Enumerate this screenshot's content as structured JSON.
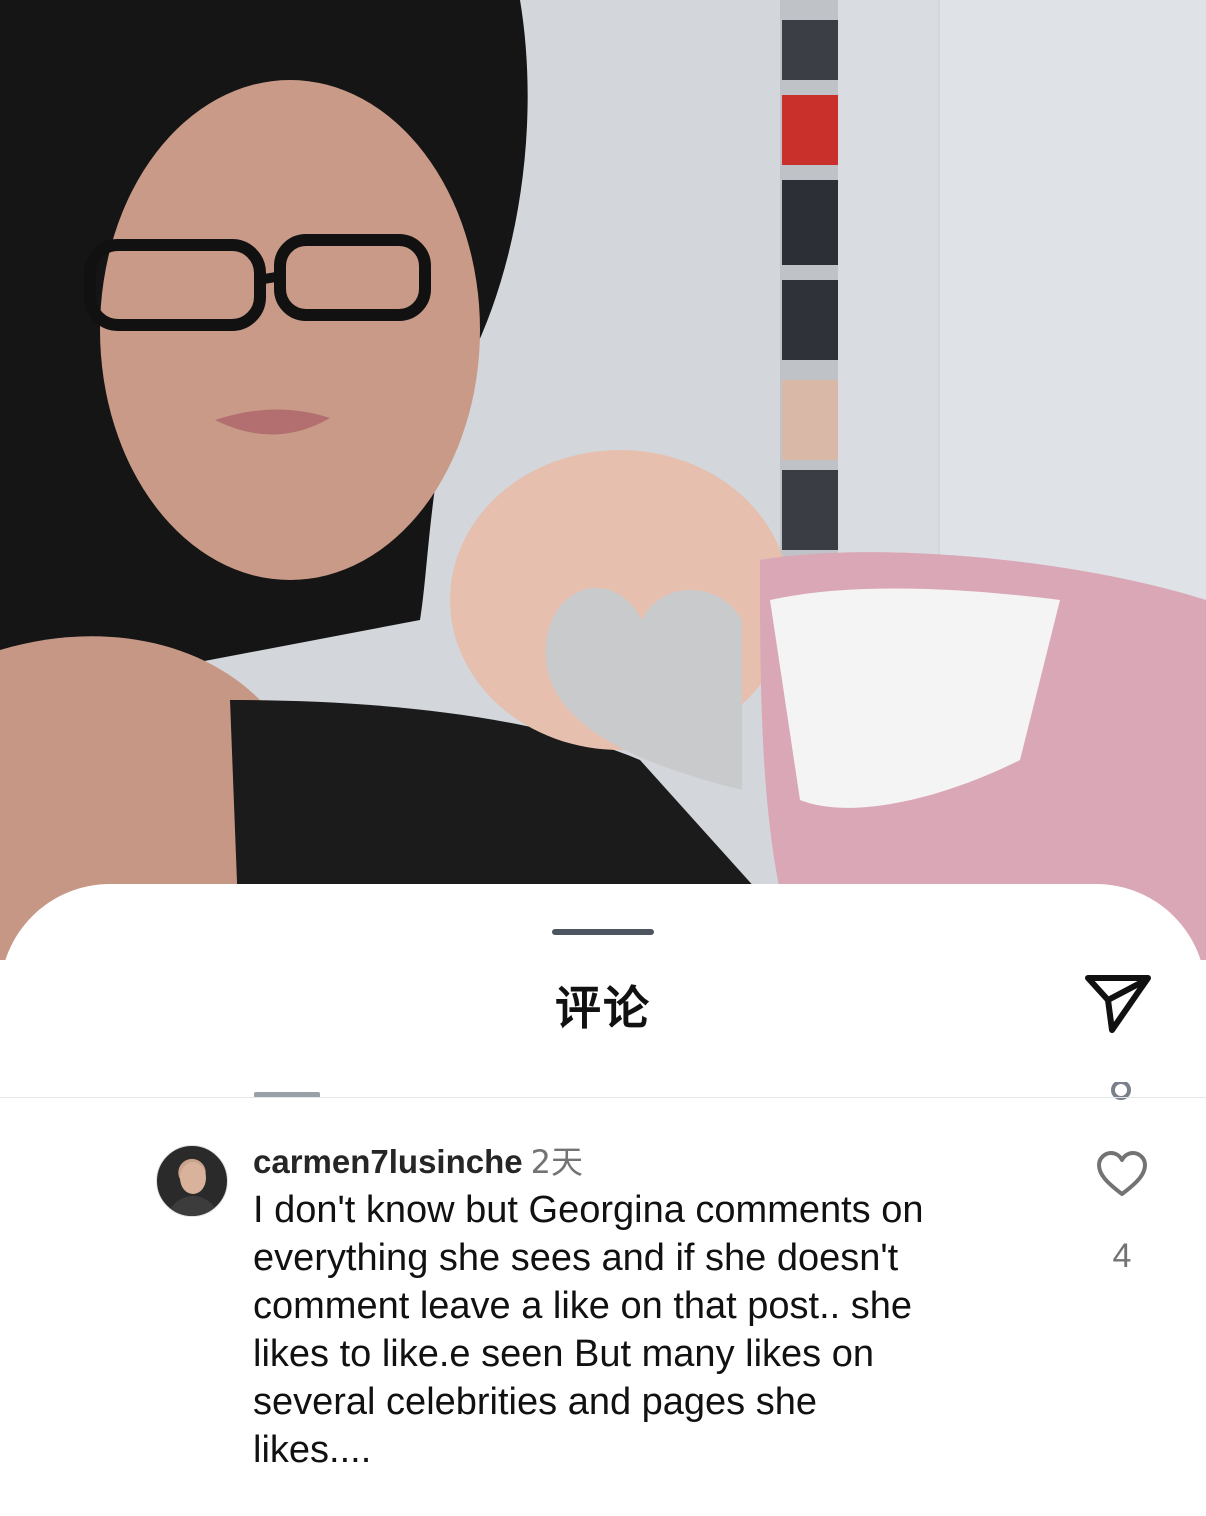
{
  "photo": {
    "description_icon": "photo-post-image",
    "heart_sticker_icon": "heart-sticker-icon"
  },
  "sheet": {
    "title": "评论",
    "share_icon": "share-send-icon"
  },
  "comment": {
    "username": "carmen7lusinche",
    "time": "2天",
    "text": "I don't know but Georgina comments on\neverything she sees and if she doesn't\ncomment leave a like on that post.. she\nlikes to like.e seen But many likes on\nseveral celebrities and pages she\nlikes....",
    "like_count": "4",
    "like_icon": "heart-outline-icon"
  },
  "colors": {
    "text_primary": "#111111",
    "text_secondary": "#737373",
    "divider": "#e4e6ea",
    "grabber": "#4d5560"
  }
}
